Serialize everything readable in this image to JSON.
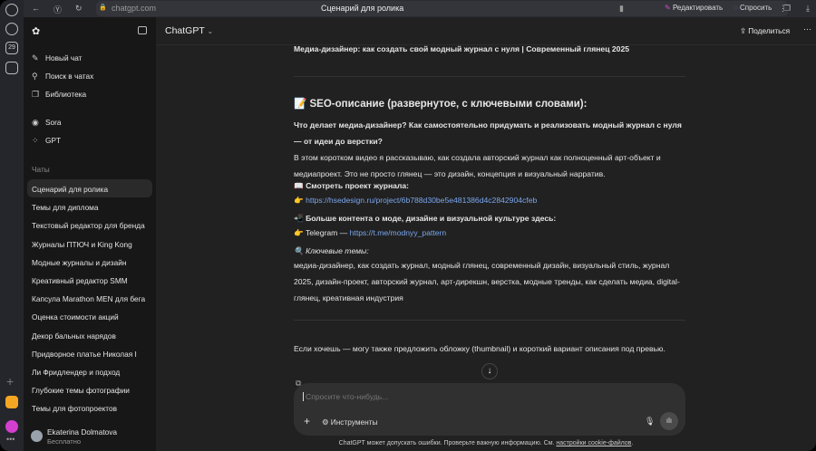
{
  "browser": {
    "url": "chatgpt.com",
    "tab_title": "Сценарий для ролика",
    "edit_label": "Редактировать",
    "ask_label": "Спросить",
    "calendar_day": "29"
  },
  "sidebar": {
    "new_chat": "Новый чат",
    "search": "Поиск в чатах",
    "library": "Библиотека",
    "sora": "Sora",
    "gpt": "GPT",
    "chats_heading": "Чаты",
    "chats": [
      "Сценарий для ролика",
      "Темы для диплома",
      "Текстовый редактор для бренда",
      "Журналы ПТЮЧ и King Kong",
      "Модные журналы и дизайн",
      "Креативный редактор SMM",
      "Капсула Marathon MEN для бега",
      "Оценка стоимости акций",
      "Декор бальных нарядов",
      "Придворное платье Николая I",
      "Ли Фридлендер и подход",
      "Глубокие темы фотографии",
      "Темы для фотопроектов"
    ],
    "user_name": "Ekaterina Dolmatova",
    "user_plan": "Бесплатно"
  },
  "header": {
    "model": "ChatGPT",
    "share": "Поделиться"
  },
  "message": {
    "title_line": "Медиа-дизайнер: как создать свой модный журнал с нуля | Современный глянец 2025",
    "seo_heading": "📝 SEO-описание (развернутое, с ключевыми словами):",
    "seo_bold": "Что делает медиа-дизайнер? Как самостоятельно придумать и реализовать модный журнал с нуля — от идеи до верстки?",
    "seo_text": "В этом коротком видео я рассказываю, как создала авторский журнал как полноценный арт-объект и медиапроект. Это не просто глянец — это дизайн, концепция и визуальный нарратив.",
    "project_label": "📖 Смотреть проект журнала:",
    "project_url": "https://hsedesign.ru/project/6b788d30be5e481386d4c2842904cfeb",
    "more_label": "📲 Больше контента о моде, дизайне и визуальной культуре здесь:",
    "telegram_prefix": "Telegram — ",
    "telegram_url": "https://t.me/modnyy_pattern",
    "keywords_label": "Ключевые темы:",
    "keywords": "медиа-дизайнер, как создать журнал, модный глянец, современный дизайн, визуальный стиль, журнал 2025, дизайн-проект, авторский журнал, арт-дирекшн, верстка, модные тренды, как сделать медиа, digital-глянец, креативная индустрия",
    "closing": "Если хочешь — могу также предложить обложку (thumbnail) и короткий вариант описания под превью."
  },
  "composer": {
    "placeholder": "Спросите что-нибудь...",
    "tools": "Инструменты"
  },
  "footer": {
    "text": "ChatGPT может допускать ошибки. Проверьте важную информацию. См. ",
    "link": "настройки cookie-файлов",
    "end": "."
  }
}
